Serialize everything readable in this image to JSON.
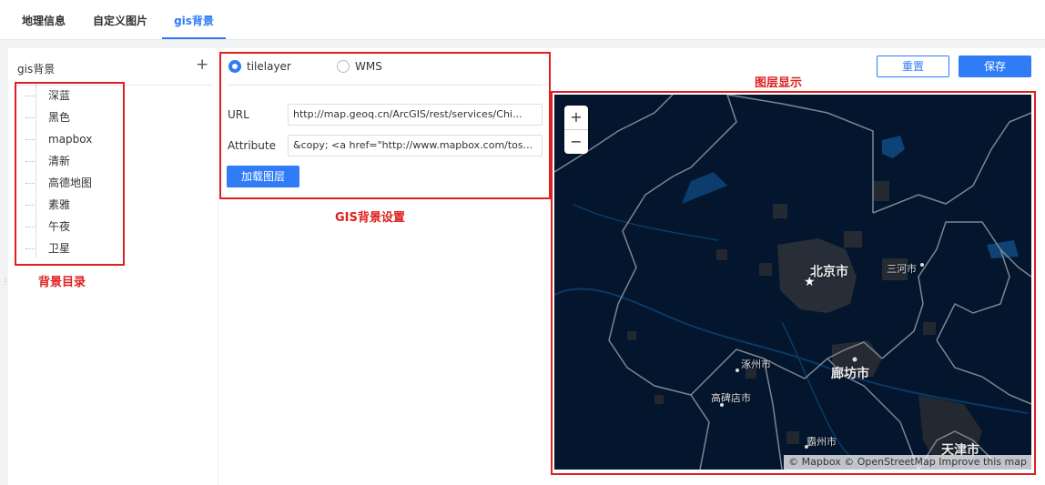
{
  "tabs": [
    {
      "label": "地理信息",
      "active": false
    },
    {
      "label": "自定义图片",
      "active": false
    },
    {
      "label": "gis背景",
      "active": true
    }
  ],
  "sidebar": {
    "title": "gis背景",
    "add_icon": "plus-icon",
    "items": [
      "深蓝",
      "黑色",
      "mapbox",
      "清新",
      "高德地图",
      "素雅",
      "午夜",
      "卫星"
    ]
  },
  "settings": {
    "radio_options": [
      {
        "label": "tilelayer",
        "selected": true
      },
      {
        "label": "WMS",
        "selected": false
      }
    ],
    "url_label": "URL",
    "url_value": "http://map.geoq.cn/ArcGIS/rest/services/Chi...",
    "attribution_label": "Attribute",
    "attribution_value": "&copy; <a href=\"http://www.mapbox.com/tos...",
    "load_button": "加载图层"
  },
  "toolbar": {
    "reset_button": "重置",
    "save_button": "保存"
  },
  "map": {
    "zoom_in": "+",
    "zoom_out": "−",
    "attribution": "© Mapbox © OpenStreetMap Improve this map",
    "cities": [
      "北京市",
      "三河市",
      "涿州市",
      "廊坊市",
      "高碑店市",
      "霸州市",
      "天津市"
    ],
    "background_color": "#04162d"
  },
  "annotations": {
    "catalog": "背景目录",
    "settings": "GIS背景设置",
    "display": "图层显示"
  },
  "colors": {
    "accent": "#2f7cf6",
    "annotation_red": "#e02020"
  }
}
